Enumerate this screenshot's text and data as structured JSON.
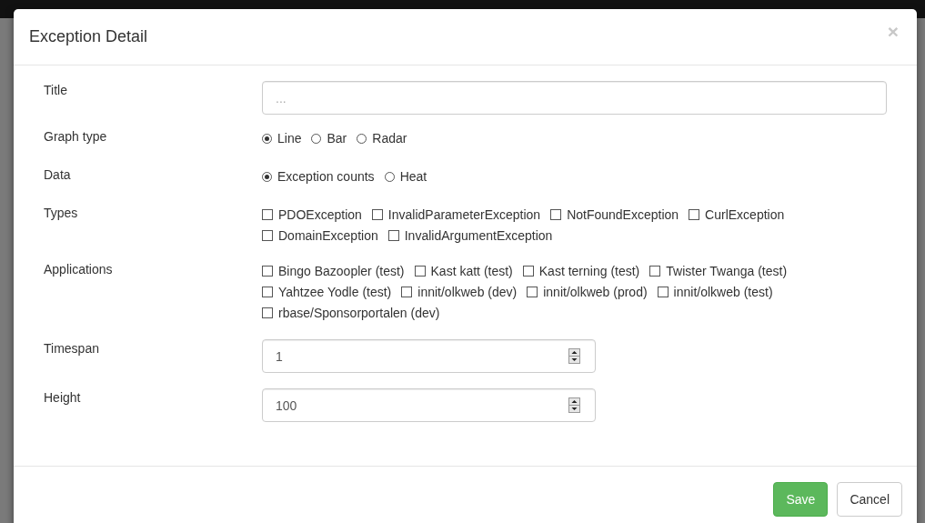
{
  "dialog": {
    "title": "Exception Detail",
    "close": "×"
  },
  "fields": [
    {
      "kind": "text",
      "label": "Title",
      "placeholder": "..."
    },
    {
      "kind": "radio",
      "label": "Graph type",
      "options": [
        {
          "label": "Line",
          "selected": true
        },
        {
          "label": "Bar",
          "selected": false
        },
        {
          "label": "Radar",
          "selected": false
        }
      ]
    },
    {
      "kind": "radio",
      "label": "Data",
      "options": [
        {
          "label": "Exception counts",
          "selected": true
        },
        {
          "label": "Heat",
          "selected": false
        }
      ]
    },
    {
      "kind": "checkbox",
      "label": "Types",
      "options": [
        {
          "label": "PDOException",
          "checked": false
        },
        {
          "label": "InvalidParameterException",
          "checked": false
        },
        {
          "label": "NotFoundException",
          "checked": false
        },
        {
          "label": "CurlException",
          "checked": false
        },
        {
          "label": "DomainException",
          "checked": false
        },
        {
          "label": "InvalidArgumentException",
          "checked": false
        }
      ]
    },
    {
      "kind": "checkbox",
      "label": "Applications",
      "options": [
        {
          "label": "Bingo Bazoopler (test)",
          "checked": false
        },
        {
          "label": "Kast katt (test)",
          "checked": false
        },
        {
          "label": "Kast terning (test)",
          "checked": false
        },
        {
          "label": "Twister Twanga (test)",
          "checked": false
        },
        {
          "label": "Yahtzee Yodle (test)",
          "checked": false
        },
        {
          "label": "innit/olkweb (dev)",
          "checked": false
        },
        {
          "label": "innit/olkweb (prod)",
          "checked": false
        },
        {
          "label": "innit/olkweb (test)",
          "checked": false
        },
        {
          "label": "rbase/Sponsorportalen (dev)",
          "checked": false
        }
      ]
    },
    {
      "kind": "number",
      "label": "Timespan",
      "value": "1"
    },
    {
      "kind": "number",
      "label": "Height",
      "value": "100"
    }
  ],
  "buttons": [
    {
      "label": "Save",
      "kind": "primary"
    },
    {
      "label": "Cancel",
      "kind": "default"
    }
  ]
}
